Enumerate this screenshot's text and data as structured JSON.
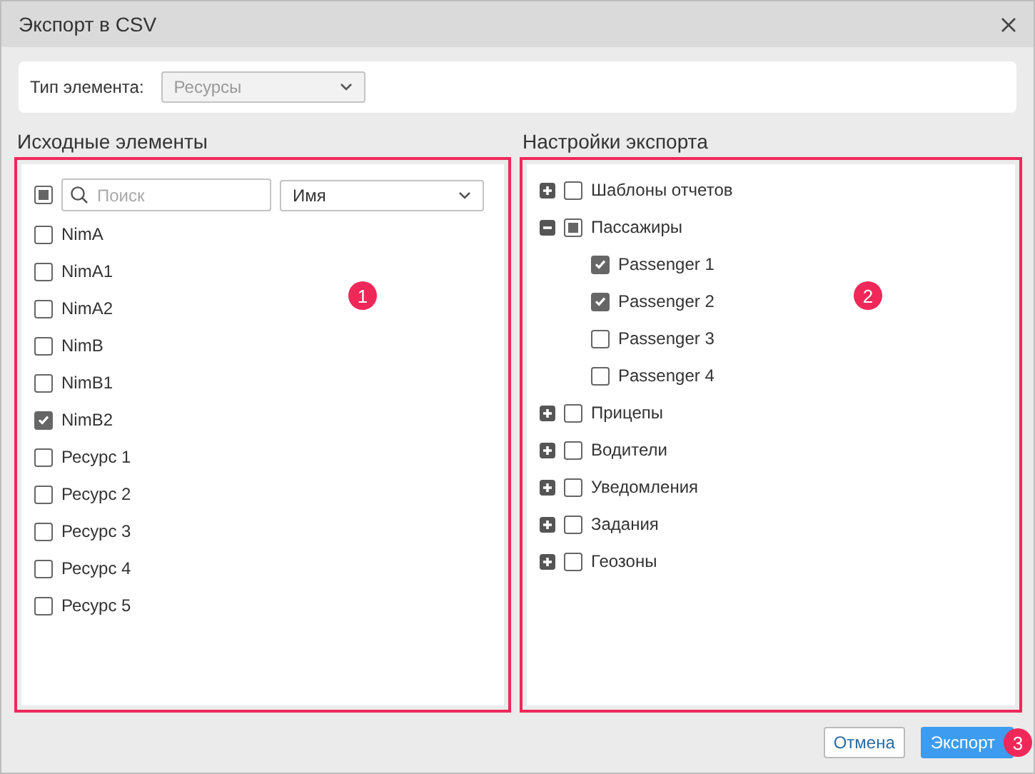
{
  "window": {
    "title": "Экспорт в CSV"
  },
  "element_type": {
    "label": "Тип элемента:",
    "value": "Ресурсы",
    "disabled": true
  },
  "source": {
    "title": "Исходные элементы",
    "highlighted": true,
    "callout": "1",
    "select_all": {
      "checked": false,
      "partial": true
    },
    "search": {
      "placeholder": "Поиск"
    },
    "sort": {
      "value": "Имя"
    },
    "items": [
      {
        "label": "NimA",
        "checked": false
      },
      {
        "label": "NimA1",
        "checked": false
      },
      {
        "label": "NimA2",
        "checked": false
      },
      {
        "label": "NimB",
        "checked": false
      },
      {
        "label": "NimB1",
        "checked": false
      },
      {
        "label": "NimB2",
        "checked": true
      },
      {
        "label": "Ресурс 1",
        "checked": false
      },
      {
        "label": "Ресурс 2",
        "checked": false
      },
      {
        "label": "Ресурс 3",
        "checked": false
      },
      {
        "label": "Ресурс 4",
        "checked": false
      },
      {
        "label": "Ресурс 5",
        "checked": false
      }
    ]
  },
  "settings": {
    "title": "Настройки экспорта",
    "highlighted": true,
    "callout": "2",
    "tree": [
      {
        "label": "Шаблоны отчетов",
        "expanded": false,
        "checked": false,
        "partial": false
      },
      {
        "label": "Пассажиры",
        "expanded": true,
        "checked": false,
        "partial": true,
        "children": [
          {
            "label": "Passenger 1",
            "checked": true
          },
          {
            "label": "Passenger 2",
            "checked": true
          },
          {
            "label": "Passenger 3",
            "checked": false
          },
          {
            "label": "Passenger 4",
            "checked": false
          }
        ]
      },
      {
        "label": "Прицепы",
        "expanded": false,
        "checked": false,
        "partial": false
      },
      {
        "label": "Водители",
        "expanded": false,
        "checked": false,
        "partial": false
      },
      {
        "label": "Уведомления",
        "expanded": false,
        "checked": false,
        "partial": false
      },
      {
        "label": "Задания",
        "expanded": false,
        "checked": false,
        "partial": false
      },
      {
        "label": "Геозоны",
        "expanded": false,
        "checked": false,
        "partial": false
      }
    ]
  },
  "buttons": [
    {
      "label": "Отмена",
      "kind": "secondary"
    },
    {
      "label": "Экспорт",
      "kind": "primary",
      "callout": "3"
    }
  ]
}
